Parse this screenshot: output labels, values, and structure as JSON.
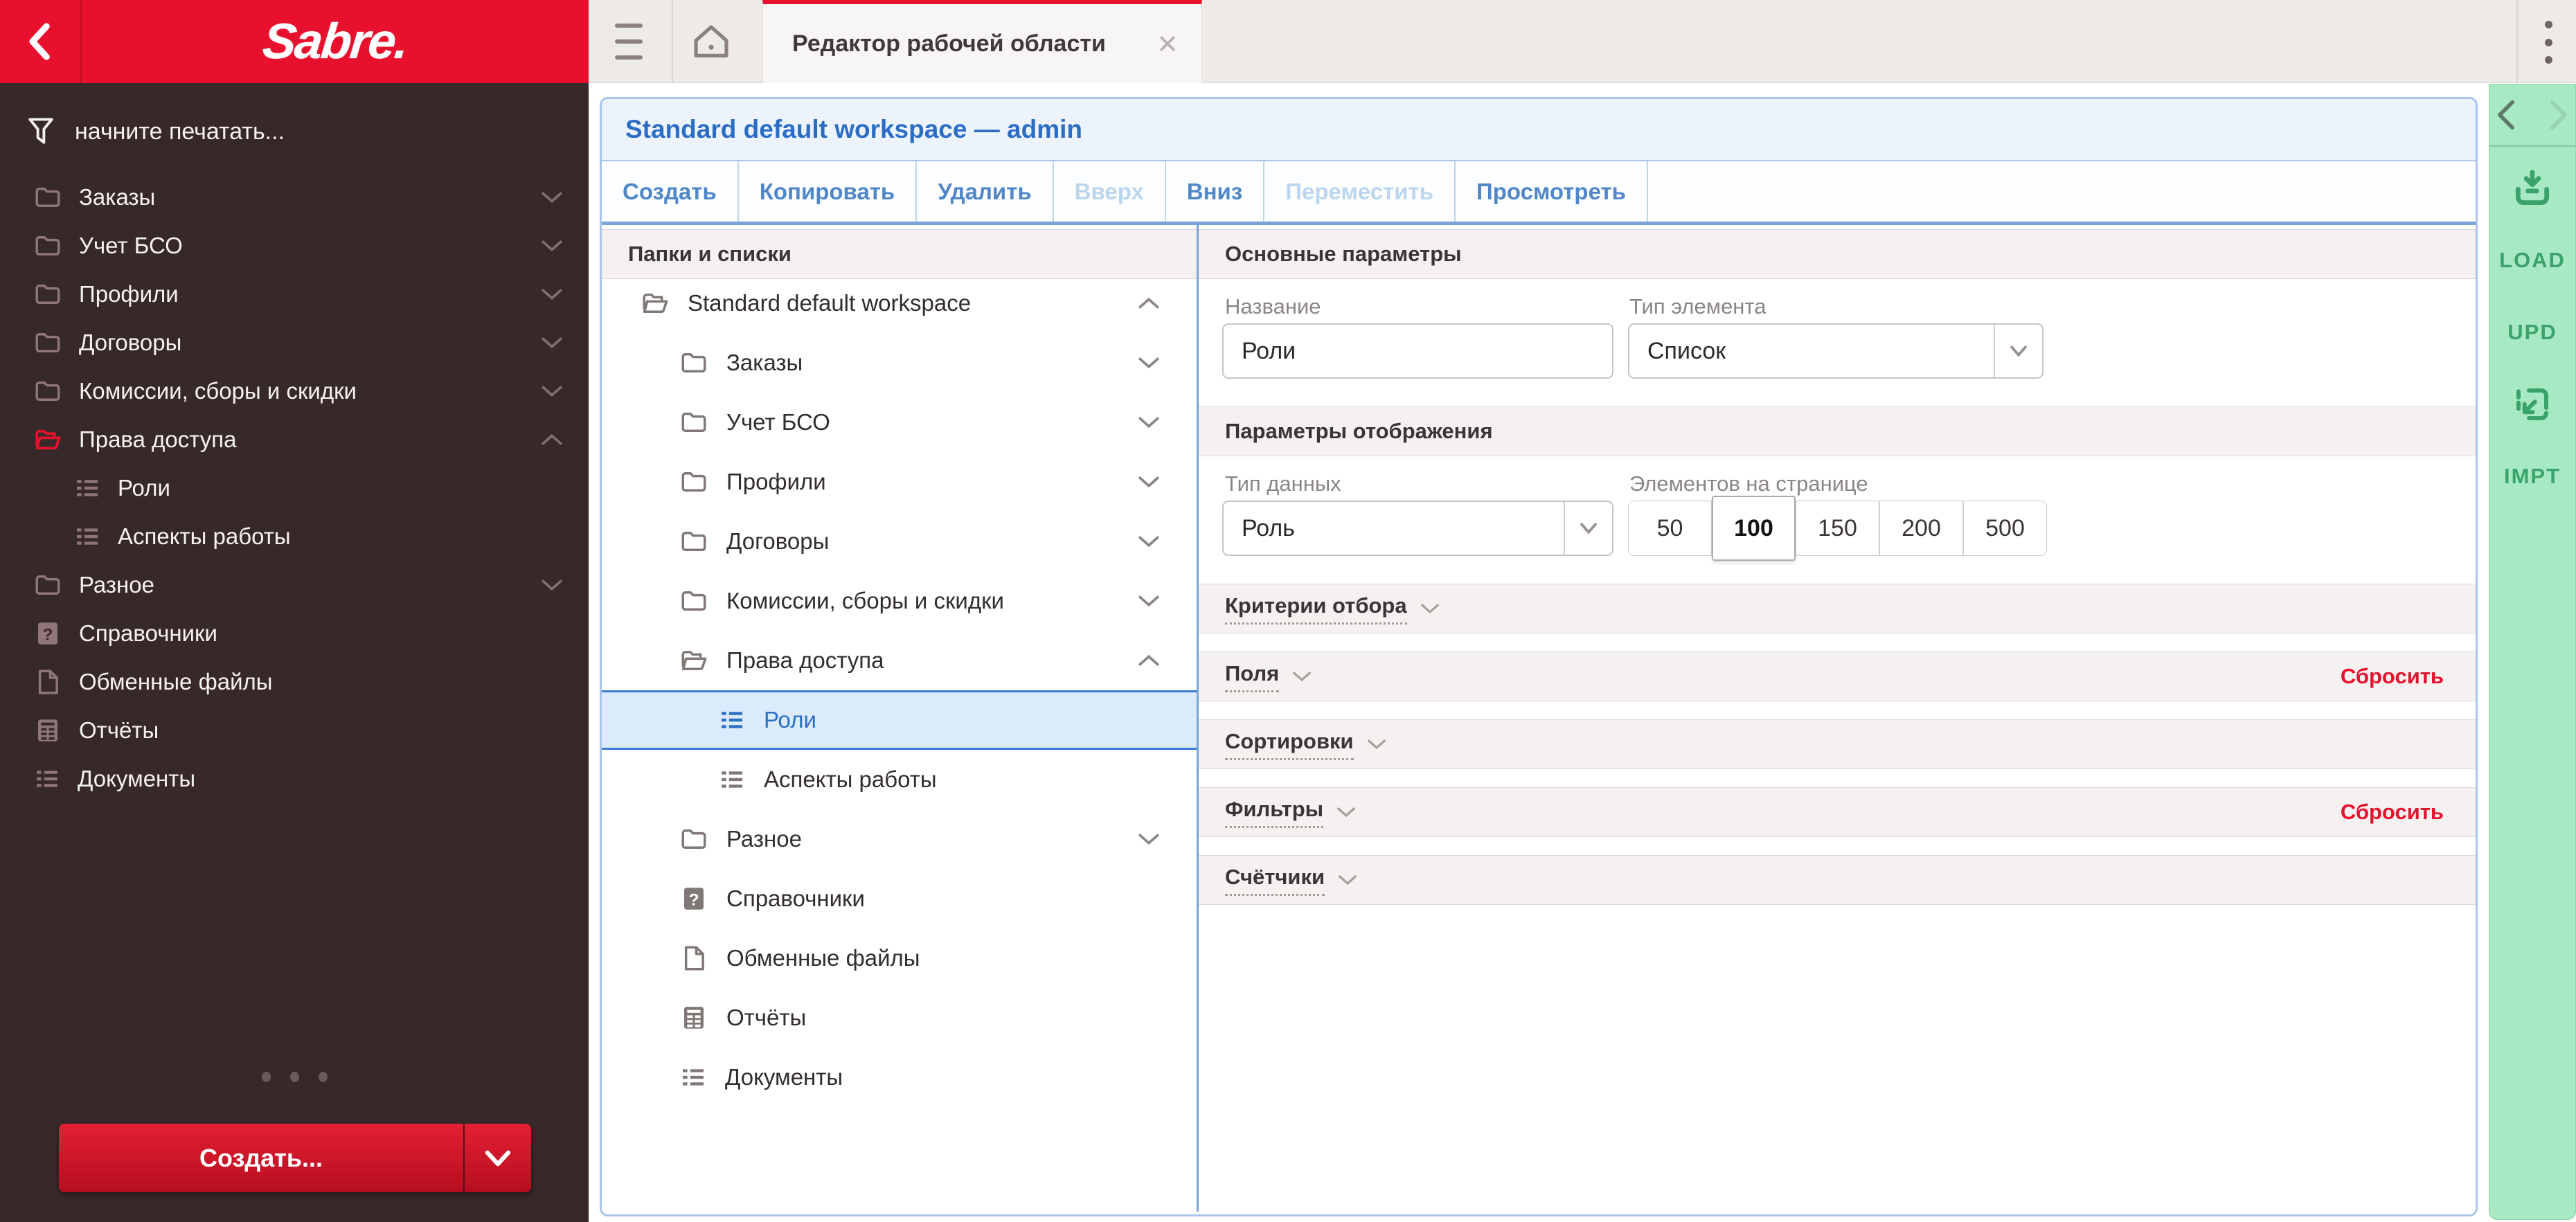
{
  "colors": {
    "sabre_red": "#E8112D",
    "sidebar_bg": "#372829",
    "accent_blue": "#2B6CC4",
    "toolbar_blue": "#4F87C8",
    "selected_row_bg": "#DCEBFB",
    "green_rail_bg": "#A6E9C2",
    "green_rail_text": "#3AA26B"
  },
  "sidebar": {
    "logo": "Sabre.",
    "search_placeholder": "начните печатать...",
    "items": [
      {
        "label": "Заказы",
        "icon": "folder",
        "level": 1,
        "chevron": "down"
      },
      {
        "label": "Учет БСО",
        "icon": "folder",
        "level": 1,
        "chevron": "down"
      },
      {
        "label": "Профили",
        "icon": "folder",
        "level": 1,
        "chevron": "down"
      },
      {
        "label": "Договоры",
        "icon": "folder",
        "level": 1,
        "chevron": "down"
      },
      {
        "label": "Комиссии, сборы и скидки",
        "icon": "folder",
        "level": 1,
        "chevron": "down"
      },
      {
        "label": "Права доступа",
        "icon": "folder-open-red",
        "level": 1,
        "chevron": "up"
      },
      {
        "label": "Роли",
        "icon": "list",
        "level": 2,
        "chevron": "none"
      },
      {
        "label": "Аспекты работы",
        "icon": "list",
        "level": 2,
        "chevron": "none"
      },
      {
        "label": "Разное",
        "icon": "folder",
        "level": 1,
        "chevron": "down"
      },
      {
        "label": "Справочники",
        "icon": "question",
        "level": 1,
        "chevron": "none"
      },
      {
        "label": "Обменные файлы",
        "icon": "file",
        "level": 1,
        "chevron": "none"
      },
      {
        "label": "Отчёты",
        "icon": "report",
        "level": 1,
        "chevron": "none"
      },
      {
        "label": "Документы",
        "icon": "list",
        "level": 1,
        "chevron": "none"
      }
    ],
    "create_button_label": "Создать..."
  },
  "topbar": {
    "tab_title": "Редактор рабочей области"
  },
  "workspace": {
    "title": "Standard default workspace — admin",
    "toolbar": [
      {
        "label": "Создать",
        "enabled": true
      },
      {
        "label": "Копировать",
        "enabled": true
      },
      {
        "label": "Удалить",
        "enabled": true
      },
      {
        "label": "Вверх",
        "enabled": false
      },
      {
        "label": "Вниз",
        "enabled": true
      },
      {
        "label": "Переместить",
        "enabled": false
      },
      {
        "label": "Просмотреть",
        "enabled": true
      }
    ]
  },
  "tree": {
    "header": "Папки и списки",
    "items": [
      {
        "label": "Standard default workspace",
        "icon": "folder-open",
        "level": 0,
        "chevron": "up",
        "selected": false
      },
      {
        "label": "Заказы",
        "icon": "folder",
        "level": 1,
        "chevron": "down",
        "selected": false
      },
      {
        "label": "Учет БСО",
        "icon": "folder",
        "level": 1,
        "chevron": "down",
        "selected": false
      },
      {
        "label": "Профили",
        "icon": "folder",
        "level": 1,
        "chevron": "down",
        "selected": false
      },
      {
        "label": "Договоры",
        "icon": "folder",
        "level": 1,
        "chevron": "down",
        "selected": false
      },
      {
        "label": "Комиссии, сборы и скидки",
        "icon": "folder",
        "level": 1,
        "chevron": "down",
        "selected": false
      },
      {
        "label": "Права доступа",
        "icon": "folder-open",
        "level": 1,
        "chevron": "up",
        "selected": false
      },
      {
        "label": "Роли",
        "icon": "list",
        "level": 2,
        "chevron": "none",
        "selected": true
      },
      {
        "label": "Аспекты работы",
        "icon": "list",
        "level": 2,
        "chevron": "none",
        "selected": false
      },
      {
        "label": "Разное",
        "icon": "folder",
        "level": 1,
        "chevron": "down",
        "selected": false
      },
      {
        "label": "Справочники",
        "icon": "question",
        "level": 1,
        "chevron": "none",
        "selected": false
      },
      {
        "label": "Обменные файлы",
        "icon": "file",
        "level": 1,
        "chevron": "none",
        "selected": false
      },
      {
        "label": "Отчёты",
        "icon": "report",
        "level": 1,
        "chevron": "none",
        "selected": false
      },
      {
        "label": "Документы",
        "icon": "list",
        "level": 1,
        "chevron": "none",
        "selected": false
      }
    ]
  },
  "params": {
    "main_header": "Основные параметры",
    "name_label": "Название",
    "name_value": "Роли",
    "type_label": "Тип элемента",
    "type_value": "Список",
    "display_header": "Параметры отображения",
    "data_type_label": "Тип данных",
    "data_type_value": "Роль",
    "page_size_label": "Элементов на странице",
    "page_sizes": [
      "50",
      "100",
      "150",
      "200",
      "500"
    ],
    "page_size_selected": "100",
    "reset_label": "Сбросить",
    "sections": [
      {
        "label": "Критерии отбора",
        "reset": false
      },
      {
        "label": "Поля",
        "reset": true
      },
      {
        "label": "Сортировки",
        "reset": false
      },
      {
        "label": "Фильтры",
        "reset": true
      },
      {
        "label": "Счётчики",
        "reset": false
      }
    ]
  },
  "right_rail": {
    "load_label": "LOAD",
    "upd_label": "UPD",
    "impt_label": "IMPT"
  }
}
